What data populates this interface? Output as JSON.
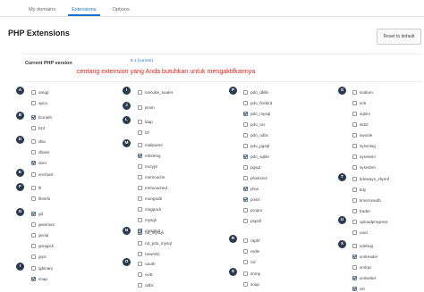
{
  "tabs": [
    {
      "label": "My domains",
      "active": false
    },
    {
      "label": "Extensions",
      "active": true
    },
    {
      "label": "Options",
      "active": false
    }
  ],
  "page_title": "PHP Extensions",
  "reset_button": "Reset to default",
  "php_version": {
    "label": "Current PHP version",
    "selected": "8.1 (current)",
    "note": "centang extension yang Anda butuhkan untuk mengaktifkannya"
  },
  "colors": {
    "accent": "#1a73c8",
    "note": "#e0231b",
    "badge": "#2b3a4e"
  },
  "groups": [
    {
      "letter": "A",
      "items": [
        {
          "name": "amqp",
          "checked": false
        },
        {
          "name": "apcu",
          "checked": false
        }
      ]
    },
    {
      "letter": "B",
      "items": [
        {
          "name": "bcmath",
          "checked": true
        },
        {
          "name": "bz2",
          "checked": false
        }
      ]
    },
    {
      "letter": "D",
      "items": [
        {
          "name": "dba",
          "checked": false
        },
        {
          "name": "dbase",
          "checked": false
        },
        {
          "name": "dom",
          "checked": true
        }
      ]
    },
    {
      "letter": "E",
      "items": [
        {
          "name": "enchant",
          "checked": false
        }
      ]
    },
    {
      "letter": "F",
      "items": [
        {
          "name": "fil",
          "checked": false
        },
        {
          "name": "fileinfo",
          "checked": false
        }
      ]
    },
    {
      "letter": "G",
      "items": [
        {
          "name": "gd",
          "checked": true
        },
        {
          "name": "gearman",
          "checked": false
        },
        {
          "name": "geoip",
          "checked": false
        },
        {
          "name": "gmagick",
          "checked": false
        },
        {
          "name": "grpc",
          "checked": false
        }
      ]
    },
    {
      "letter": "I",
      "items": [
        {
          "name": "igbinary",
          "checked": false
        },
        {
          "name": "imap",
          "checked": true
        }
      ]
    },
    {
      "letter": "I",
      "items": [
        {
          "name": "ioncube_loader",
          "checked": false
        }
      ]
    },
    {
      "letter": "J",
      "items": [
        {
          "name": "jsmin",
          "checked": false
        }
      ]
    },
    {
      "letter": "L",
      "items": [
        {
          "name": "ldap",
          "checked": false
        },
        {
          "name": "lzf",
          "checked": false
        }
      ]
    },
    {
      "letter": "M",
      "items": [
        {
          "name": "mailparse",
          "checked": false
        },
        {
          "name": "mbstring",
          "checked": true
        },
        {
          "name": "mcrypt",
          "checked": false
        },
        {
          "name": "memcache",
          "checked": false
        },
        {
          "name": "memcached",
          "checked": false
        },
        {
          "name": "mongodb",
          "checked": false
        },
        {
          "name": "msgpack",
          "checked": false
        },
        {
          "name": "mysqli",
          "checked": false
        },
        {
          "name": "mysqlnd",
          "checked": true
        }
      ]
    },
    {
      "letter": "N",
      "items": [
        {
          "name": "nd_mysqli",
          "checked": true
        },
        {
          "name": "nd_pdo_mysql",
          "checked": false
        },
        {
          "name": "newrelic",
          "checked": false
        }
      ]
    },
    {
      "letter": "O",
      "items": [
        {
          "name": "oauth",
          "checked": false
        },
        {
          "name": "oci8",
          "checked": false
        },
        {
          "name": "odbc",
          "checked": false
        }
      ]
    },
    {
      "letter": "P",
      "items": [
        {
          "name": "pdo_dblib",
          "checked": false
        },
        {
          "name": "pdo_firebird",
          "checked": false
        },
        {
          "name": "pdo_mysql",
          "checked": true
        },
        {
          "name": "pdo_oci",
          "checked": false
        },
        {
          "name": "pdo_odbc",
          "checked": false
        },
        {
          "name": "pdo_pgsql",
          "checked": false
        },
        {
          "name": "pdo_sqlite",
          "checked": true
        },
        {
          "name": "pgsql",
          "checked": false
        },
        {
          "name": "phalcon3",
          "checked": false
        },
        {
          "name": "phar",
          "checked": true
        },
        {
          "name": "posix",
          "checked": true
        },
        {
          "name": "propro",
          "checked": false
        },
        {
          "name": "pspell",
          "checked": false
        }
      ]
    },
    {
      "letter": "R",
      "items": [
        {
          "name": "raphf",
          "checked": false
        },
        {
          "name": "redis",
          "checked": false
        },
        {
          "name": "rrd",
          "checked": false
        }
      ]
    },
    {
      "letter": "S",
      "items": [
        {
          "name": "snmp",
          "checked": false
        },
        {
          "name": "soap",
          "checked": false
        }
      ]
    },
    {
      "letter": "S",
      "items": [
        {
          "name": "sodium",
          "checked": false
        },
        {
          "name": "solr",
          "checked": false
        },
        {
          "name": "sqlsrv",
          "checked": false
        },
        {
          "name": "ssh2",
          "checked": false
        },
        {
          "name": "swoole",
          "checked": false
        },
        {
          "name": "sysvmsg",
          "checked": false
        },
        {
          "name": "sysvsem",
          "checked": false
        },
        {
          "name": "sysvshm",
          "checked": false
        }
      ]
    },
    {
      "letter": "T",
      "items": [
        {
          "name": "tideways_xhprof",
          "checked": false
        },
        {
          "name": "tidy",
          "checked": false
        },
        {
          "name": "timezonedb",
          "checked": false
        },
        {
          "name": "trader",
          "checked": false
        }
      ]
    },
    {
      "letter": "U",
      "items": [
        {
          "name": "uploadprogress",
          "checked": false
        },
        {
          "name": "uuid",
          "checked": false
        }
      ]
    },
    {
      "letter": "X",
      "items": [
        {
          "name": "xdebug",
          "checked": false
        },
        {
          "name": "xmlreader",
          "checked": true
        },
        {
          "name": "xmlrpc",
          "checked": false
        },
        {
          "name": "xmlwriter",
          "checked": true
        },
        {
          "name": "xsl",
          "checked": true
        }
      ]
    }
  ]
}
